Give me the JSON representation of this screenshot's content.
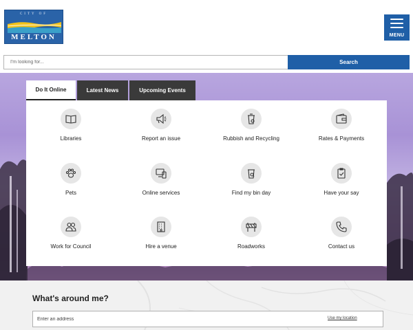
{
  "header": {
    "logo": {
      "top_text": "CITY OF",
      "bottom_text": "MELTON"
    },
    "menu_label": "MENU"
  },
  "search": {
    "placeholder": "I'm looking for...",
    "button_label": "Search"
  },
  "tabs": [
    {
      "label": "Do It Online",
      "active": true
    },
    {
      "label": "Latest News",
      "active": false
    },
    {
      "label": "Upcoming Events",
      "active": false
    }
  ],
  "tiles": [
    {
      "label": "Libraries",
      "icon": "book-icon"
    },
    {
      "label": "Report an issue",
      "icon": "megaphone-icon"
    },
    {
      "label": "Rubbish and Recycling",
      "icon": "bin-icon"
    },
    {
      "label": "Rates & Payments",
      "icon": "wallet-icon"
    },
    {
      "label": "Pets",
      "icon": "paw-icon"
    },
    {
      "label": "Online services",
      "icon": "devices-icon"
    },
    {
      "label": "Find my bin day",
      "icon": "bin-search-icon"
    },
    {
      "label": "Have your say",
      "icon": "clipboard-check-icon"
    },
    {
      "label": "Work for Council",
      "icon": "people-icon"
    },
    {
      "label": "Hire a venue",
      "icon": "building-icon"
    },
    {
      "label": "Roadworks",
      "icon": "barrier-icon"
    },
    {
      "label": "Contact us",
      "icon": "phone-icon"
    }
  ],
  "around": {
    "title": "What's around me?",
    "address_placeholder": "Enter an address",
    "use_location_label": "Use my location"
  },
  "colors": {
    "brand_blue": "#1f5fa7",
    "tab_dark": "#3a3a3a",
    "icon_bg": "#e6e6e6"
  }
}
